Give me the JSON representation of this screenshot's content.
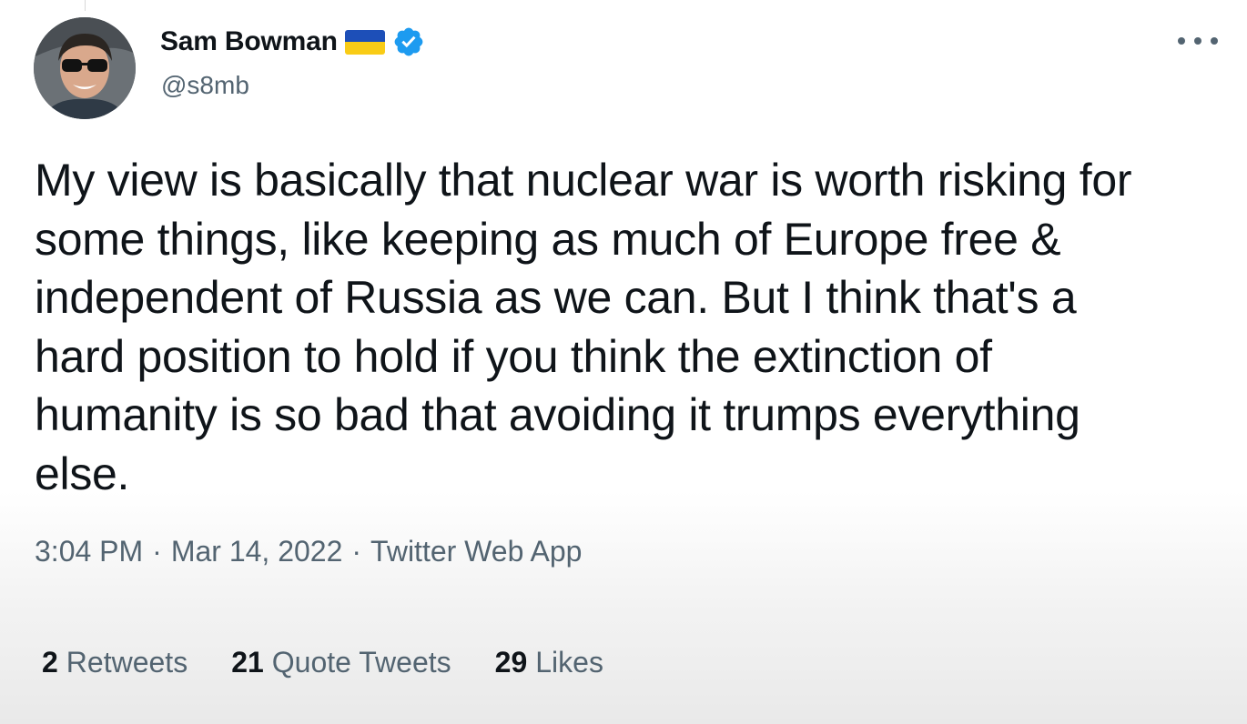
{
  "tweet": {
    "author": {
      "display_name": "Sam Bowman",
      "handle": "@s8mb",
      "badges": [
        "ukraine-flag-icon",
        "verified-badge-icon"
      ]
    },
    "text": "My view is basically that nuclear war is worth risking for\nsome things, like keeping as much of Europe free &\nindependent of Russia as we can. But I think that's a\nhard position to hold if you think the extinction of\nhumanity is so bad that avoiding it trumps everything\nelse.",
    "meta": {
      "time": "3:04 PM",
      "separator": "·",
      "date": "Mar 14, 2022",
      "source": "Twitter Web App"
    },
    "stats": [
      {
        "count": "2",
        "label": "Retweets"
      },
      {
        "count": "21",
        "label": "Quote Tweets"
      },
      {
        "count": "29",
        "label": "Likes"
      }
    ]
  },
  "colors": {
    "text": "#0f1419",
    "secondary": "#536471",
    "verified": "#1d9bf0",
    "flag_blue": "#1d4fb8",
    "flag_yellow": "#f9cc16"
  }
}
